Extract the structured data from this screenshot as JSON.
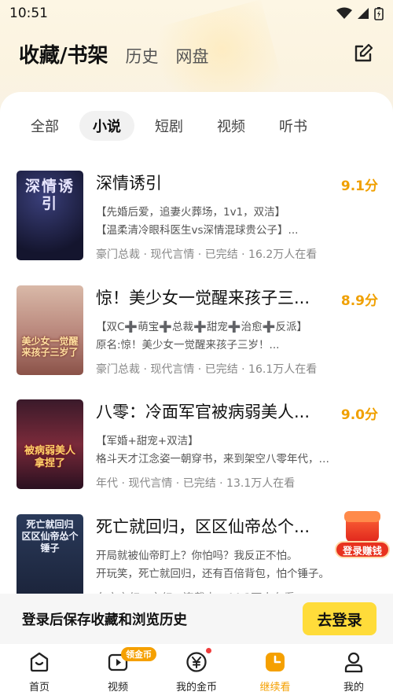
{
  "status": {
    "time": "10:51"
  },
  "header": {
    "title": "收藏/书架",
    "tabs": [
      "历史",
      "网盘"
    ],
    "edit_icon": "edit-icon"
  },
  "filters": [
    "全部",
    "小说",
    "短剧",
    "视频",
    "听书"
  ],
  "active_filter": "小说",
  "books": [
    {
      "title": "深情诱引",
      "score": "9.1分",
      "line1": "【先婚后爱，追妻火葬场，1v1，双洁】",
      "line2": "【温柔清冷眼科医生vs深情混球贵公子】...",
      "meta": "豪门总裁 · 现代言情 · 已完结 · 16.2万人在看",
      "cover_text": "深情诱引"
    },
    {
      "title": "惊！美少女一觉醒来孩子三...",
      "score": "8.9分",
      "line1": "【双C➕萌宝➕总裁➕甜宠➕治愈➕反派】",
      "line2": "原名:惊！美少女一觉醒来孩子三岁！...",
      "meta": "豪门总裁 · 现代言情 · 已完结 · 16.1万人在看",
      "cover_text": "美少女一觉醒来孩子三岁了"
    },
    {
      "title": "八零：冷面军官被病弱美人...",
      "score": "9.0分",
      "line1": "【军婚+甜宠+双洁】",
      "line2": "格斗天才江念姿一朝穿书，来到架空八零年代，成...",
      "meta": "年代 · 现代言情 · 已完结 · 13.1万人在看",
      "cover_text": "被病弱美人拿捏了"
    },
    {
      "title": "死亡就回归，区区仙帝怂个...",
      "score": "",
      "line1": "开局就被仙帝盯上？你怕吗？我反正不怕。",
      "line2": "开玩笑，死亡就回归，还有百倍背包，怕个锤子。",
      "meta": "东方玄幻 · 玄幻 · 连载中 · 44.3万人在看",
      "cover_text": "死亡就回归 区区仙帝怂个锤子"
    }
  ],
  "float_badge": {
    "label": "登录赚钱"
  },
  "login_bar": {
    "tip": "登录后保存收藏和浏览历史",
    "button": "去登录"
  },
  "tabbar": {
    "items": [
      {
        "label": "首页",
        "icon": "home-icon"
      },
      {
        "label": "视频",
        "icon": "video-icon",
        "badge": "领金币"
      },
      {
        "label": "我的金币",
        "icon": "coin-icon"
      },
      {
        "label": "继续看",
        "icon": "clock-icon"
      },
      {
        "label": "我的",
        "icon": "user-icon"
      }
    ],
    "active_index": 3
  },
  "colors": {
    "accent": "#f5a000",
    "button": "#ffdc3a",
    "score": "#f0a000"
  }
}
